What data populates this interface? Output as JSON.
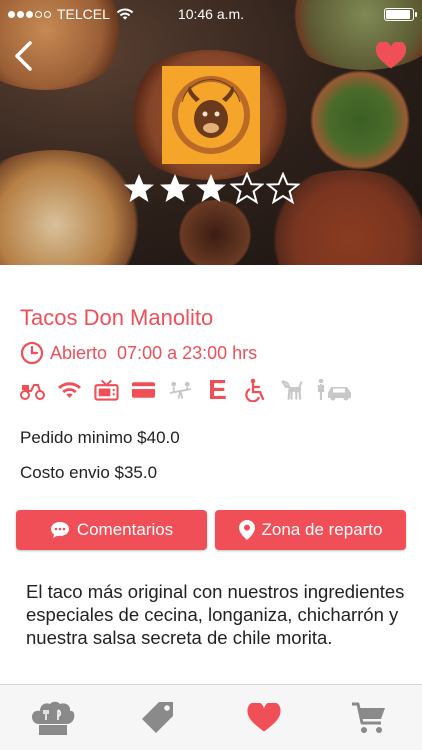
{
  "status_bar": {
    "carrier": "TELCEL",
    "time": "10:46 a.m.",
    "signal_bars": 3,
    "signal_total": 5,
    "battery_level": 0.95
  },
  "header": {
    "back_icon": "chevron-left-icon",
    "favorite_icon": "heart-icon",
    "logo_text": "Tacos Don Manolito",
    "rating": 3,
    "rating_max": 5
  },
  "restaurant": {
    "name": "Tacos Don Manolito",
    "status": "Abierto",
    "hours": "07:00 a 23:00 hrs",
    "minimum_order": "Pedido minimo $40.0",
    "shipping_cost": "Costo envio $35.0",
    "description": "El taco más original con nuestros ingredientes especiales de cecina, longaniza, chicharrón y nuestra salsa secreta de chile morita."
  },
  "amenities": [
    {
      "icon": "delivery-scooter-icon",
      "active": true
    },
    {
      "icon": "wifi-icon",
      "active": true
    },
    {
      "icon": "tv-icon",
      "active": true
    },
    {
      "icon": "credit-card-icon",
      "active": true
    },
    {
      "icon": "playground-icon",
      "active": false
    },
    {
      "icon": "letter-e-icon",
      "active": true,
      "label": "E"
    },
    {
      "icon": "wheelchair-icon",
      "active": true
    },
    {
      "icon": "pet-dog-icon",
      "active": false
    },
    {
      "icon": "valet-parking-icon",
      "active": false
    }
  ],
  "buttons": {
    "comments": "Comentarios",
    "delivery_zone": "Zona de reparto"
  },
  "tabs": [
    {
      "icon": "chef-hat-icon",
      "active": false
    },
    {
      "icon": "tag-icon",
      "active": false
    },
    {
      "icon": "heart-icon",
      "active": true
    },
    {
      "icon": "cart-icon",
      "active": false
    }
  ],
  "colors": {
    "accent": "#f04f58",
    "inactive_icon": "#c8c8c8",
    "tab_icon": "#8a8a8a",
    "logo_bg": "#f4a52a"
  }
}
